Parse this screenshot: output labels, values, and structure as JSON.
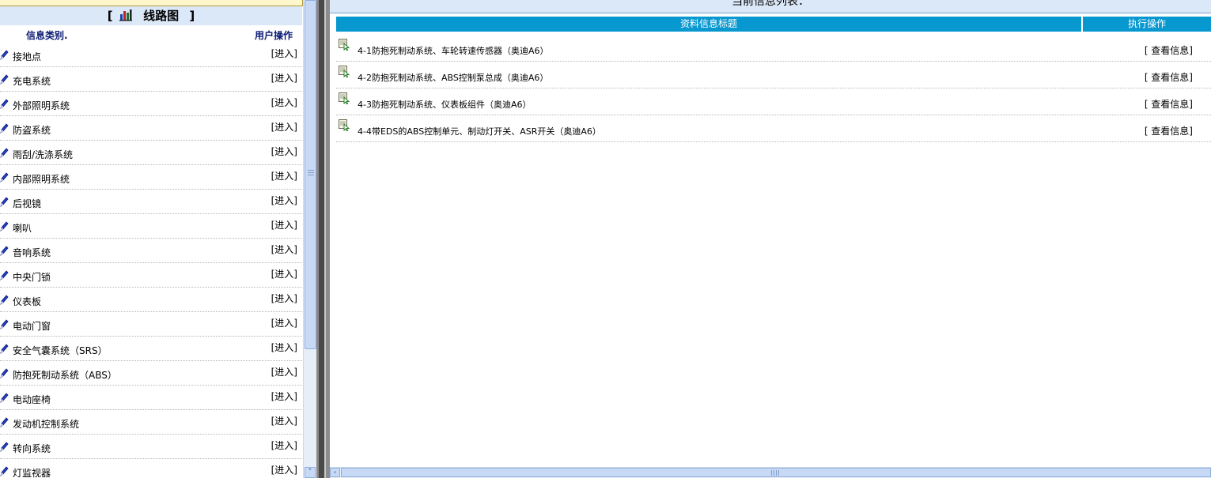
{
  "left_panel": {
    "title_prefix": "[",
    "title": "线路图",
    "title_suffix": "]",
    "col_category": "信息类别.",
    "col_action": "用户操作",
    "enter_label": "[进入]",
    "categories": [
      "接地点",
      "充电系统",
      "外部照明系统",
      "防盗系统",
      "雨刮/洗涤系统",
      "内部照明系统",
      "后视镜",
      "喇叭",
      "音响系统",
      "中央门锁",
      "仪表板",
      "电动门窗",
      "安全气囊系统（SRS）",
      "防抱死制动系统（ABS）",
      "电动座椅",
      "发动机控制系统",
      "转向系统",
      "灯监视器"
    ]
  },
  "right_panel": {
    "heading": "当前信息列表：",
    "col_title": "资料信息标题",
    "col_action": "执行操作",
    "view_label": "[ 查看信息]",
    "rows": [
      "4-1防抱死制动系统、车轮转速传感器（奥迪A6）",
      "4-2防抱死制动系统、ABS控制泵总成（奥迪A6）",
      "4-3防抱死制动系统、仪表板组件（奥迪A6）",
      "4-4带EDS的ABS控制单元、制动灯开关、ASR开关（奥迪A6）"
    ]
  },
  "icons": {
    "category_item": "pencil-icon",
    "info_item": "document-cursor-icon",
    "title": "bar-chart-icon"
  },
  "colors": {
    "table_header_bg": "#0898d0",
    "panel_title_bg": "#dbe8f8",
    "category_header_text": "#0b1b74"
  }
}
